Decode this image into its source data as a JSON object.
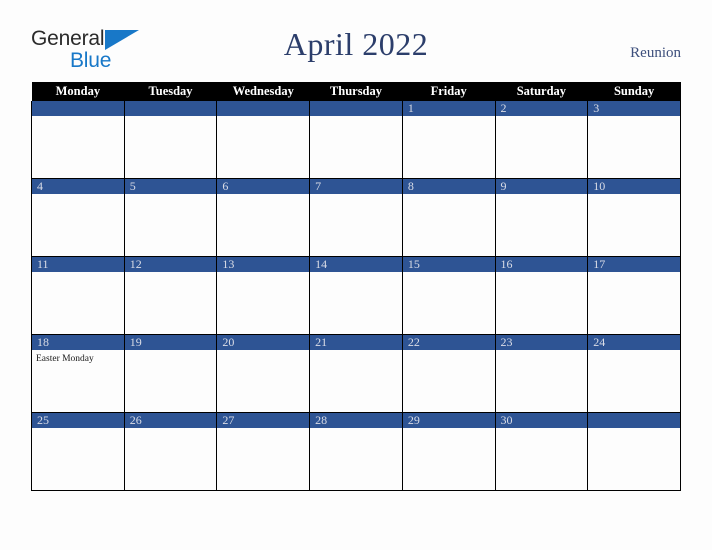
{
  "brand": {
    "name_part1": "General",
    "name_part2": "Blue"
  },
  "header": {
    "title": "April 2022",
    "region": "Reunion"
  },
  "calendar": {
    "weekdays": [
      "Monday",
      "Tuesday",
      "Wednesday",
      "Thursday",
      "Friday",
      "Saturday",
      "Sunday"
    ],
    "colors": {
      "date_bar": "#2e5494",
      "header_bar": "#000000",
      "title": "#2c3e6b",
      "brand_blue": "#1878c8",
      "page_background": "#fdfdfd"
    },
    "weeks": [
      [
        {
          "date": "",
          "event": ""
        },
        {
          "date": "",
          "event": ""
        },
        {
          "date": "",
          "event": ""
        },
        {
          "date": "",
          "event": ""
        },
        {
          "date": "1",
          "event": ""
        },
        {
          "date": "2",
          "event": ""
        },
        {
          "date": "3",
          "event": ""
        }
      ],
      [
        {
          "date": "4",
          "event": ""
        },
        {
          "date": "5",
          "event": ""
        },
        {
          "date": "6",
          "event": ""
        },
        {
          "date": "7",
          "event": ""
        },
        {
          "date": "8",
          "event": ""
        },
        {
          "date": "9",
          "event": ""
        },
        {
          "date": "10",
          "event": ""
        }
      ],
      [
        {
          "date": "11",
          "event": ""
        },
        {
          "date": "12",
          "event": ""
        },
        {
          "date": "13",
          "event": ""
        },
        {
          "date": "14",
          "event": ""
        },
        {
          "date": "15",
          "event": ""
        },
        {
          "date": "16",
          "event": ""
        },
        {
          "date": "17",
          "event": ""
        }
      ],
      [
        {
          "date": "18",
          "event": "Easter Monday"
        },
        {
          "date": "19",
          "event": ""
        },
        {
          "date": "20",
          "event": ""
        },
        {
          "date": "21",
          "event": ""
        },
        {
          "date": "22",
          "event": ""
        },
        {
          "date": "23",
          "event": ""
        },
        {
          "date": "24",
          "event": ""
        }
      ],
      [
        {
          "date": "25",
          "event": ""
        },
        {
          "date": "26",
          "event": ""
        },
        {
          "date": "27",
          "event": ""
        },
        {
          "date": "28",
          "event": ""
        },
        {
          "date": "29",
          "event": ""
        },
        {
          "date": "30",
          "event": ""
        },
        {
          "date": "",
          "event": ""
        }
      ]
    ]
  }
}
